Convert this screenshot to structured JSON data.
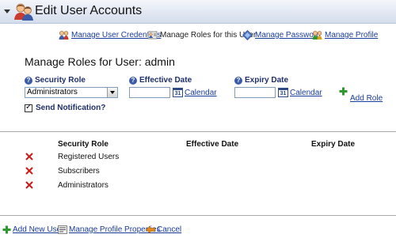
{
  "header": {
    "title": "Edit User Accounts",
    "icon": "users-icon"
  },
  "top_links": [
    {
      "label": "Manage User Credentials",
      "icon": "credentials-icon",
      "link": true
    },
    {
      "label": "Manage Roles for this User",
      "icon": "roles-icon",
      "link": false
    },
    {
      "label": "Manage Password",
      "icon": "password-icon",
      "link": true
    },
    {
      "label": "Manage Profile",
      "icon": "profile-icon",
      "link": true
    }
  ],
  "section_title": "Manage Roles for User: admin",
  "form": {
    "security_role_label": "Security Role",
    "security_role_value": "Administrators",
    "effective_date_label": "Effective Date",
    "expiry_date_label": "Expiry Date",
    "calendar_label": "Calendar",
    "calendar_icon_text": "31",
    "add_role_label": "Add Role",
    "send_notification_label": "Send Notification?",
    "send_notification_checked": true
  },
  "table": {
    "headers": [
      "Security Role",
      "Effective Date",
      "Expiry Date"
    ],
    "rows": [
      {
        "role": "Registered Users",
        "effective": "",
        "expiry": ""
      },
      {
        "role": "Subscribers",
        "effective": "",
        "expiry": ""
      },
      {
        "role": "Administrators",
        "effective": "",
        "expiry": ""
      }
    ]
  },
  "footer": {
    "add_new_user": "Add New User",
    "manage_profile_properties": "Manage Profile Properties",
    "cancel": "Cancel"
  },
  "colors": {
    "link": "#1a3c9c",
    "label": "#1f2f6a",
    "delete": "#cc1a1a",
    "add": "#2e9a2e"
  }
}
